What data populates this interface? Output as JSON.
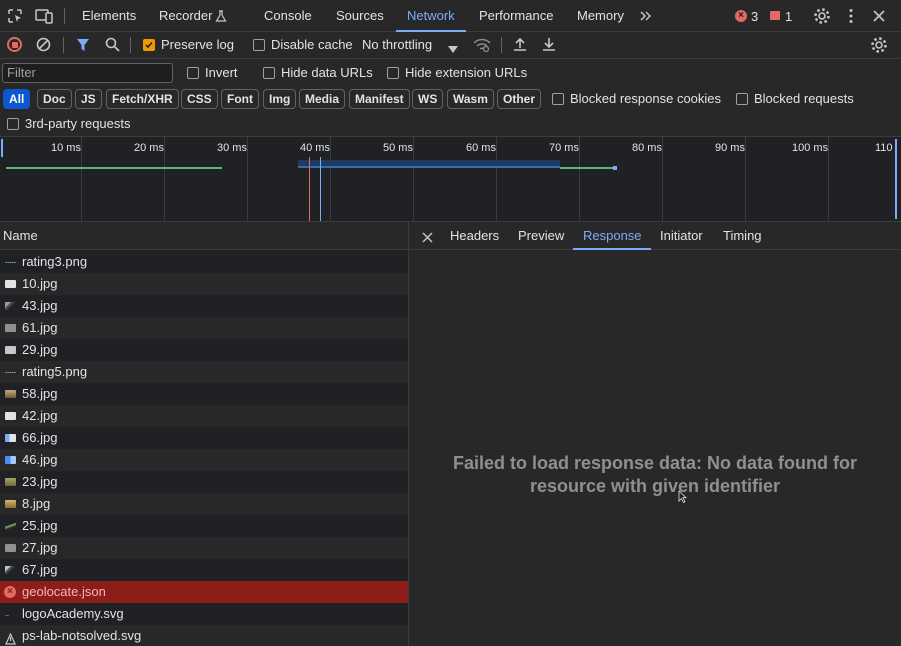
{
  "tabs": {
    "elements": "Elements",
    "recorder": "Recorder",
    "console": "Console",
    "sources": "Sources",
    "network": "Network",
    "performance": "Performance",
    "memory": "Memory"
  },
  "badges": {
    "errors": "3",
    "warnings": "1"
  },
  "toolbar": {
    "preserve_log": "Preserve log",
    "disable_cache": "Disable cache",
    "throttling": "No throttling"
  },
  "filter": {
    "placeholder": "Filter",
    "invert": "Invert",
    "hide_data_urls": "Hide data URLs",
    "hide_extension_urls": "Hide extension URLs",
    "types": [
      "All",
      "Doc",
      "JS",
      "Fetch/XHR",
      "CSS",
      "Font",
      "Img",
      "Media",
      "Manifest",
      "WS",
      "Wasm",
      "Other"
    ],
    "blocked_response_cookies": "Blocked response cookies",
    "blocked_requests": "Blocked requests",
    "third_party": "3rd-party requests"
  },
  "timeline": {
    "ticks": [
      "10 ms",
      "20 ms",
      "30 ms",
      "40 ms",
      "50 ms",
      "60 ms",
      "70 ms",
      "80 ms",
      "90 ms",
      "100 ms",
      "110"
    ]
  },
  "requests": {
    "header": "Name",
    "rows": [
      "rating3.png",
      "10.jpg",
      "43.jpg",
      "61.jpg",
      "29.jpg",
      "rating5.png",
      "58.jpg",
      "42.jpg",
      "66.jpg",
      "46.jpg",
      "23.jpg",
      "8.jpg",
      "25.jpg",
      "27.jpg",
      "67.jpg",
      "geolocate.json",
      "logoAcademy.svg",
      "ps-lab-notsolved.svg"
    ]
  },
  "details": {
    "tabs": [
      "Headers",
      "Preview",
      "Response",
      "Initiator",
      "Timing"
    ],
    "message": "Failed to load response data: No data found for resource with given identifier"
  },
  "colors": {
    "accent": "#7cacf8",
    "error": "#e46962",
    "checkbox": "#f29900"
  }
}
